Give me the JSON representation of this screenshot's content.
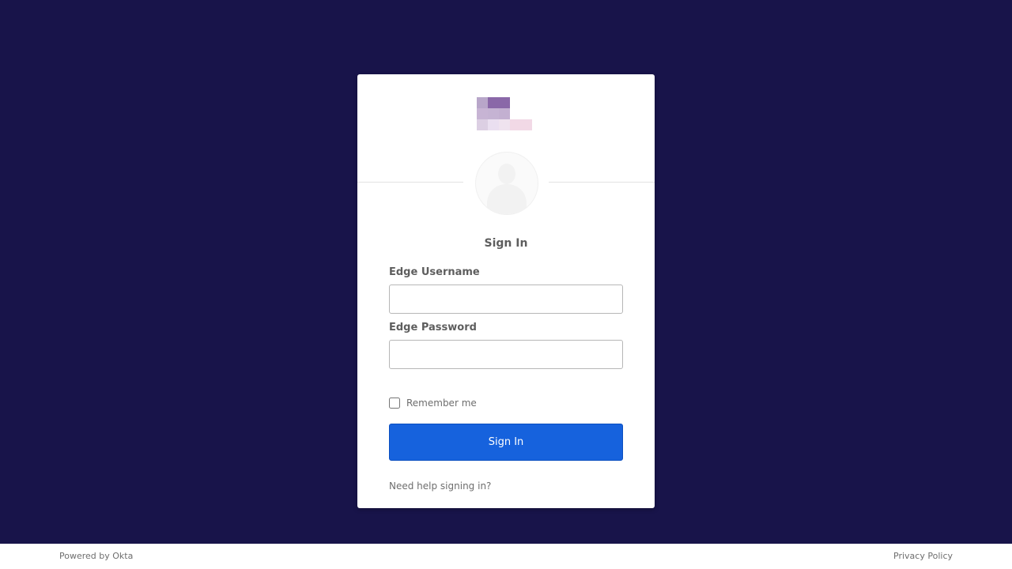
{
  "colors": {
    "background": "#18144a",
    "card": "#ffffff",
    "primary_button": "#1662dd",
    "label_text": "#5e5e5e"
  },
  "logo": {
    "icon": "org-logo-pixelated",
    "pixels": [
      "#b8a6c9",
      "#8a68a8",
      "#8a68a8",
      "#c7b4d4",
      "#c5b3d3",
      "#c3b0d1",
      "#dccfe3",
      "#eadff0",
      "#efe3ef",
      "#f2d9e6",
      "#f2d9e6"
    ]
  },
  "avatar": {
    "icon": "user-avatar-icon"
  },
  "form": {
    "title": "Sign In",
    "username_label": "Edge Username",
    "username_value": "",
    "password_label": "Edge Password",
    "password_value": "",
    "remember_label": "Remember me",
    "remember_checked": false,
    "submit_label": "Sign In",
    "help_link": "Need help signing in?"
  },
  "footer": {
    "powered_by": "Powered by Okta",
    "privacy_link": "Privacy Policy"
  }
}
